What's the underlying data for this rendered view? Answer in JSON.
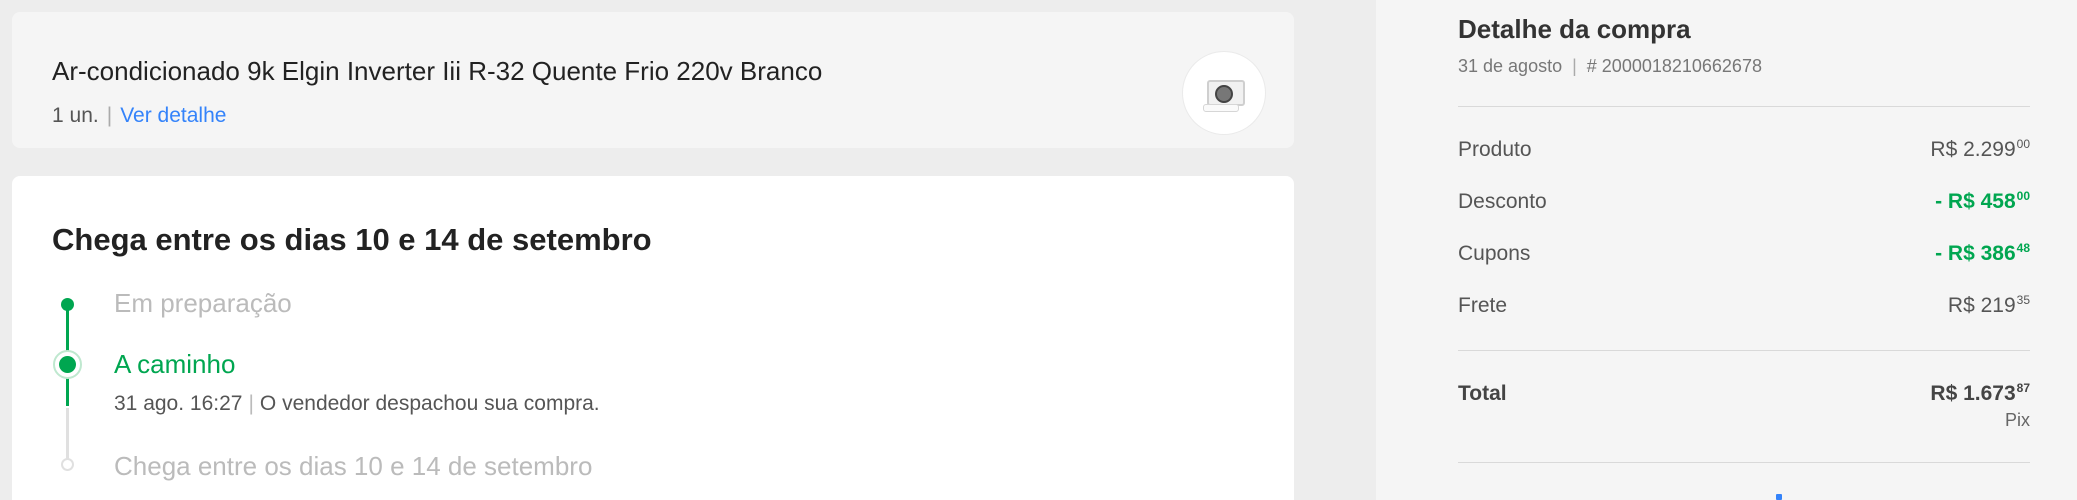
{
  "product": {
    "title": "Ar-condicionado 9k Elgin Inverter Iii R-32 Quente Frio 220v Branco",
    "quantity": "1 un.",
    "separator": "|",
    "detail_link": "Ver detalhe"
  },
  "delivery": {
    "title": "Chega entre os dias 10 e 14 de setembro",
    "steps": [
      {
        "label": "Em preparação",
        "state": "done"
      },
      {
        "label": "A caminho",
        "state": "current",
        "date": "31 ago. 16:27",
        "separator": "|",
        "message": "O vendedor despachou sua compra."
      },
      {
        "label": "Chega entre os dias 10 e 14 de setembro",
        "state": "pending"
      }
    ]
  },
  "summary": {
    "title": "Detalhe da compra",
    "date": "31 de agosto",
    "separator": "|",
    "order_number": "# 2000018210662678",
    "rows": [
      {
        "label": "Produto",
        "value": "R$ 2.299",
        "cents": "00"
      },
      {
        "label": "Desconto",
        "value": "- R$ 458",
        "cents": "00"
      },
      {
        "label": "Cupons",
        "value": "- R$ 386",
        "cents": "48"
      },
      {
        "label": "Frete",
        "value": "R$ 219",
        "cents": "35"
      }
    ],
    "total": {
      "label": "Total",
      "value": "R$ 1.673",
      "cents": "87",
      "method": "Pix"
    }
  },
  "colors": {
    "green": "#00a650",
    "link_blue": "#3483fa",
    "page_bg": "#ededed",
    "card_bg": "#ffffff"
  },
  "icons": {
    "product_thumbnail": "air-conditioner-icon",
    "timeline": "timeline-dot-icon"
  }
}
